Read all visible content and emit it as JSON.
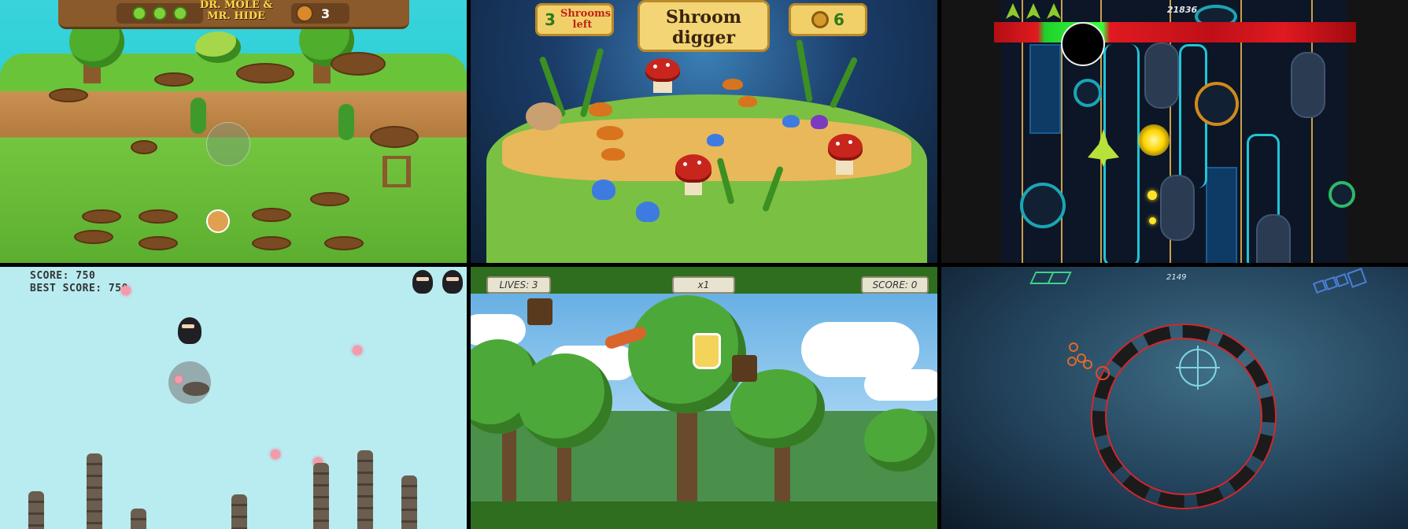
{
  "panels": {
    "mole": {
      "logo": "DR. MOLE & MR. HIDE",
      "lives": 3,
      "mole_count": "3"
    },
    "shroom": {
      "shrooms_left_value": "3",
      "shrooms_left_label": "Shrooms left",
      "logo_line1": "Shroom",
      "logo_line2": "digger",
      "coins": "6"
    },
    "shooter": {
      "score": "21836",
      "lives": 3
    },
    "ninja": {
      "score": "SCORE: 750",
      "best_score": "BEST SCORE: 750",
      "lives": 2
    },
    "forest": {
      "lives": "LIVES: 3",
      "multiplier": "x1",
      "score": "SCORE: 0"
    },
    "circle": {
      "score": "2149"
    }
  },
  "colors": {
    "grass": "#74c640",
    "neon": "#1ec6d8",
    "ring_red": "#d8262a",
    "sky": "#b9ecf0"
  },
  "icons": [
    "heart-icon",
    "mole-icon",
    "gear-icon",
    "ship-icon",
    "ninja-icon",
    "reticle-icon"
  ]
}
